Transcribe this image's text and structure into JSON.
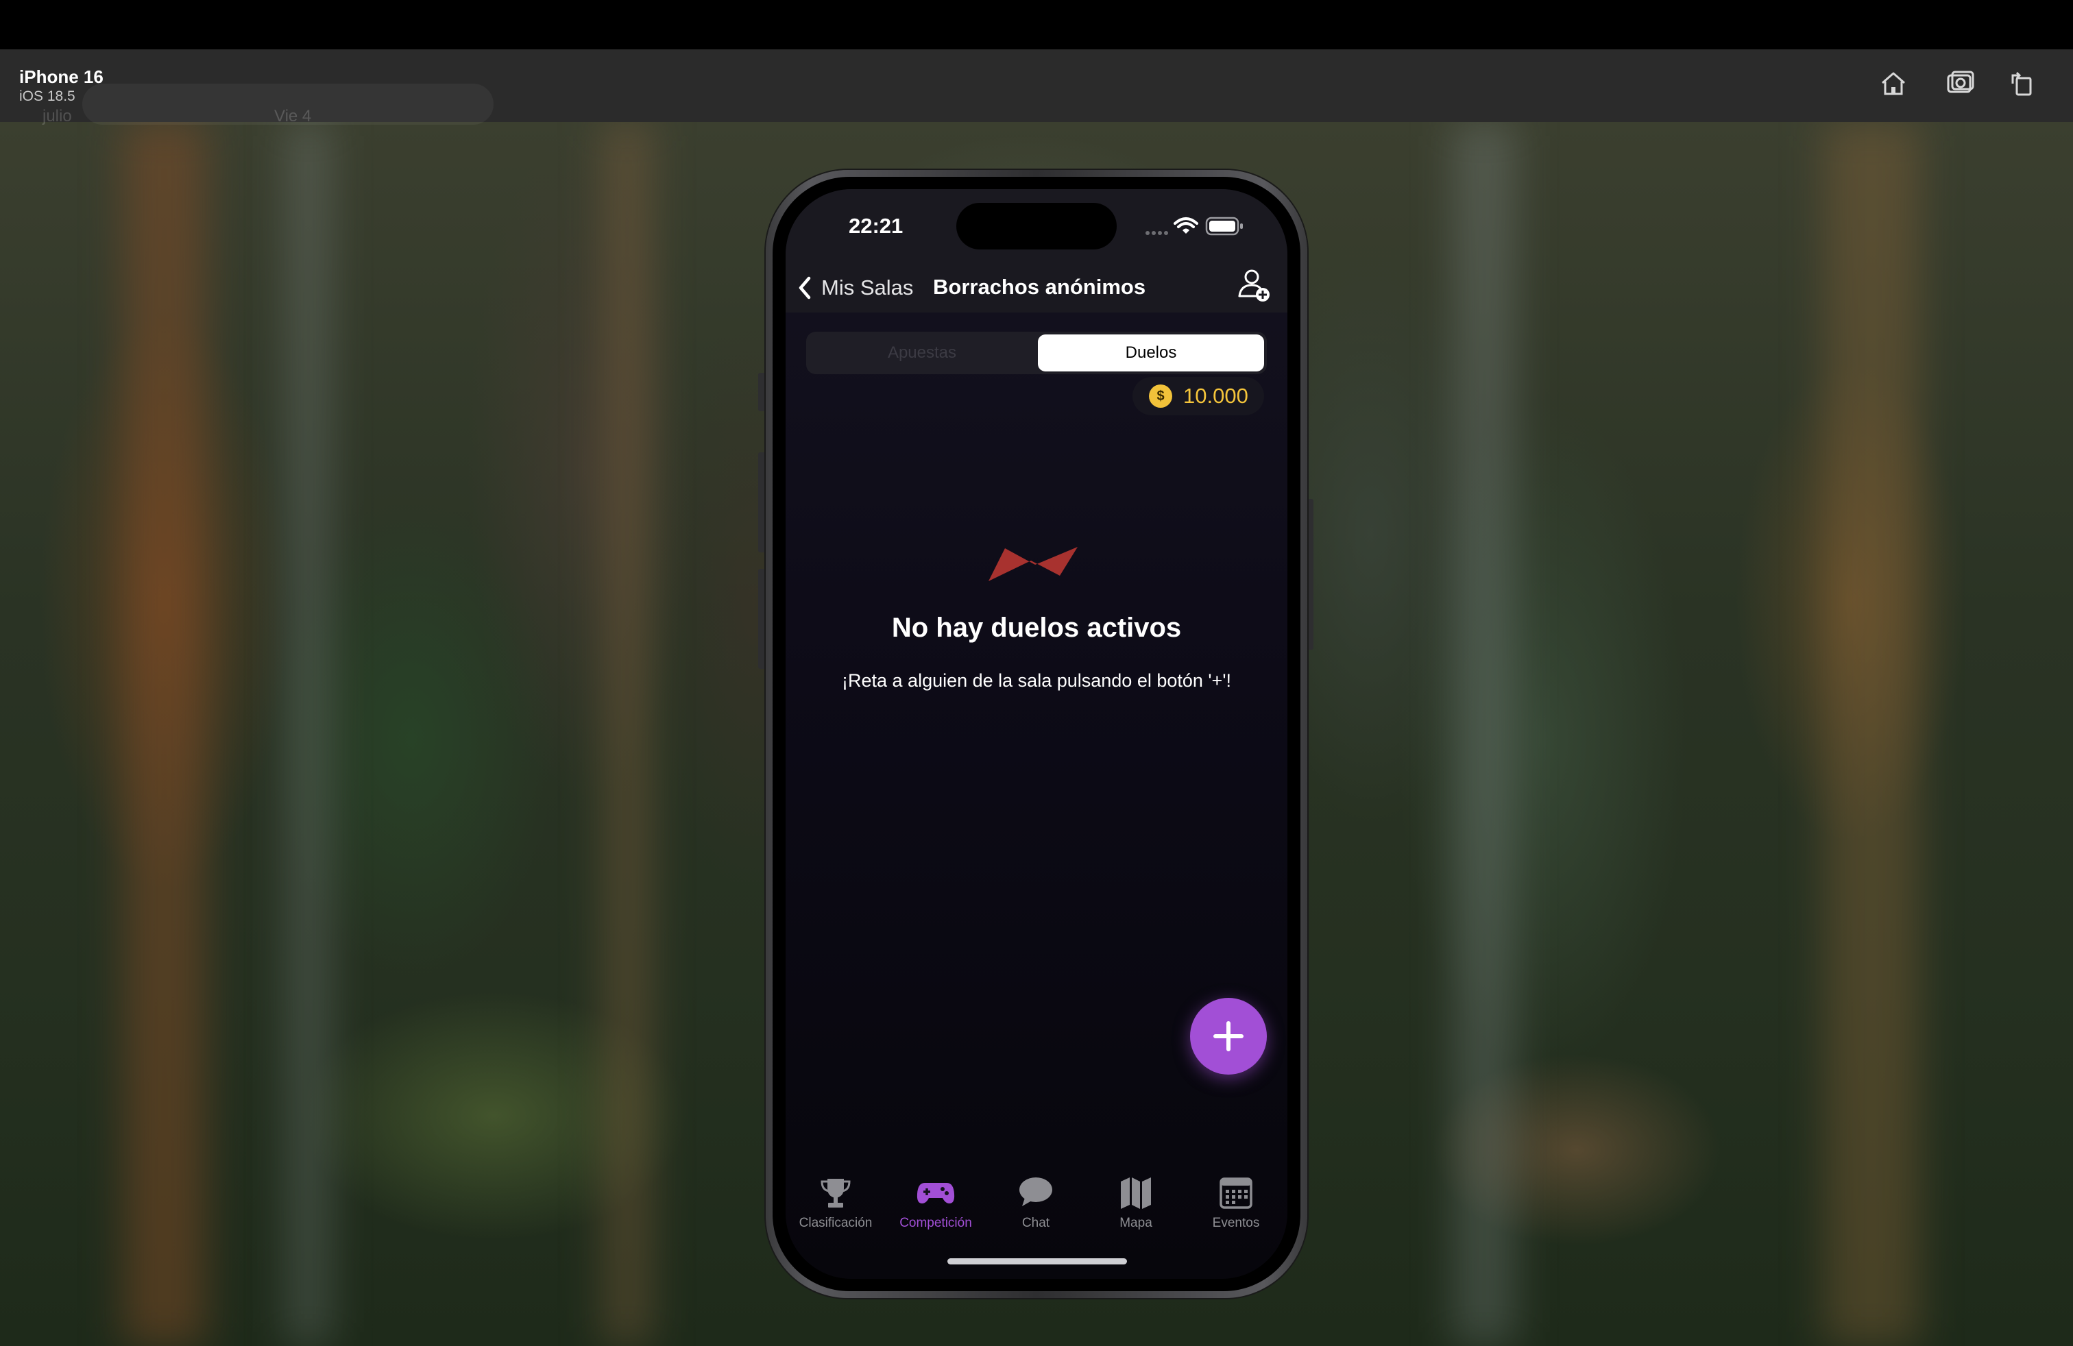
{
  "simulator": {
    "device": "iPhone 16",
    "os": "iOS 18.5",
    "ghost_left": "julio",
    "ghost_right": "Vie 4",
    "icons": [
      "home-icon",
      "screenshot-icon",
      "rotate-icon"
    ]
  },
  "status_bar": {
    "time": "22:21",
    "icons": [
      "cellular-icon",
      "wifi-icon",
      "battery-icon"
    ]
  },
  "nav": {
    "back_label": "Mis Salas",
    "title": "Borrachos anónimos",
    "right_icon": "add-user-icon"
  },
  "segments": {
    "items": [
      "Apuestas",
      "Duelos"
    ],
    "selected": "Duelos"
  },
  "balance": {
    "coin_symbol": "$",
    "value": "10.000"
  },
  "empty_state": {
    "icon": "lightning-icon",
    "title": "No hay duelos activos",
    "subtitle": "¡Reta a alguien de la sala pulsando el botón '+'!"
  },
  "fab": {
    "icon": "plus-icon"
  },
  "tabs": [
    {
      "label": "Clasificación",
      "icon": "trophy-icon"
    },
    {
      "label": "Competición",
      "icon": "gamepad-icon",
      "active": true
    },
    {
      "label": "Chat",
      "icon": "chat-bubble-icon"
    },
    {
      "label": "Mapa",
      "icon": "map-icon"
    },
    {
      "label": "Eventos",
      "icon": "calendar-icon"
    }
  ],
  "colors": {
    "accent": "#a24fd6",
    "coin": "#f2c23a",
    "empty_icon": "#a8322f"
  }
}
